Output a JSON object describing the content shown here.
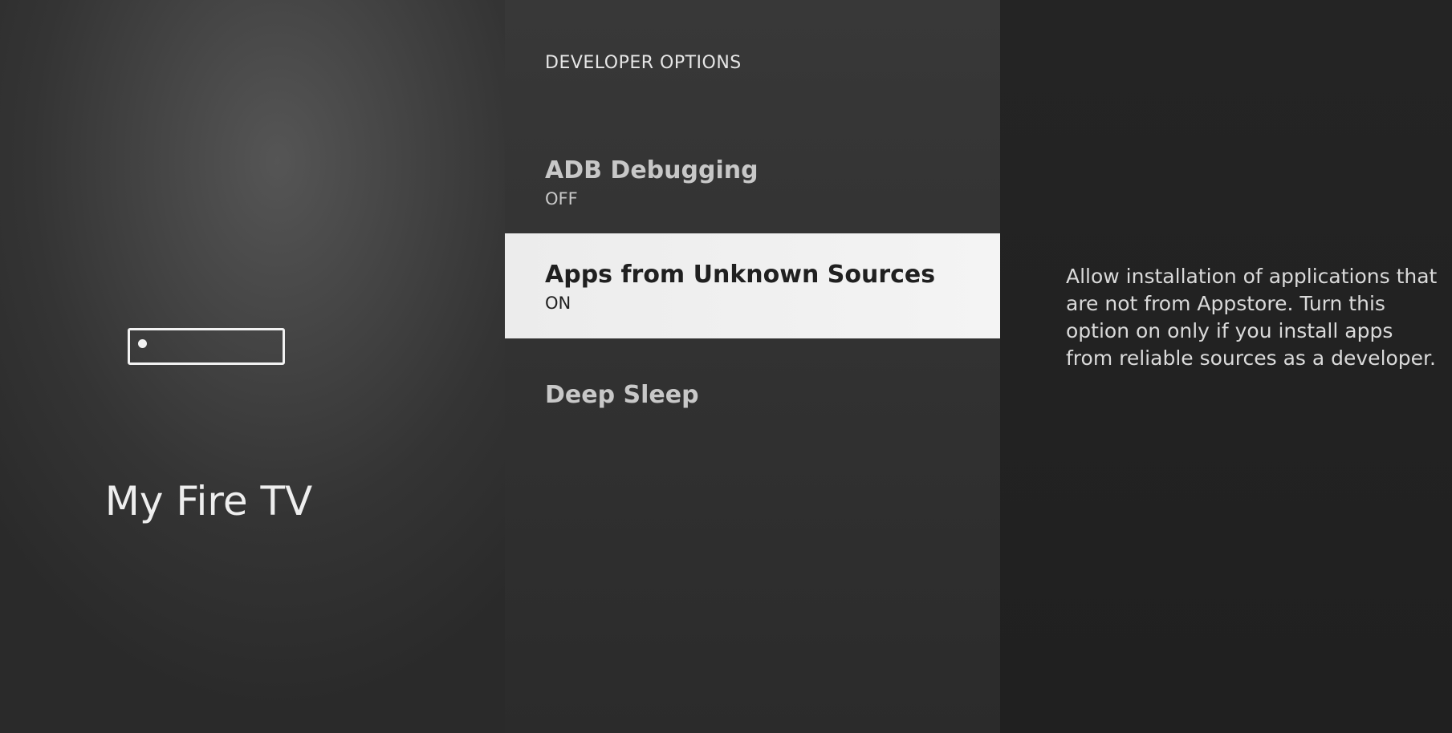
{
  "sidebar": {
    "title": "My Fire TV",
    "icon": "fire-tv-device-icon"
  },
  "menu": {
    "header": "DEVELOPER OPTIONS",
    "items": [
      {
        "label": "ADB Debugging",
        "value": "OFF"
      },
      {
        "label": "Apps from Unknown Sources",
        "value": "ON"
      },
      {
        "label": "Deep Sleep",
        "value": ""
      }
    ]
  },
  "description": {
    "text": "Allow installation of applications that are not from Appstore. Turn this option on only if you install apps from reliable sources as a developer."
  },
  "colors": {
    "selected_background": "#f0f0f0",
    "text_light": "#c8c8c8",
    "text_dark": "#202020"
  }
}
